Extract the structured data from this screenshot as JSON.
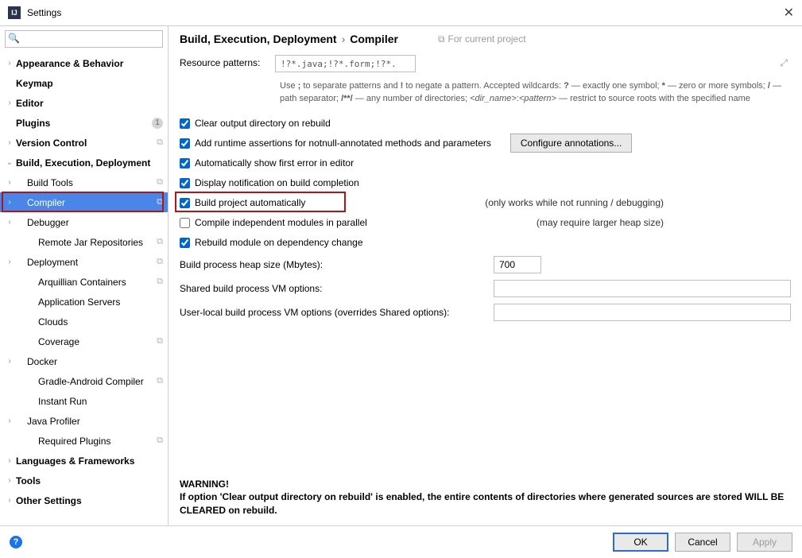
{
  "window": {
    "title": "Settings"
  },
  "search": {
    "placeholder": ""
  },
  "sidebar": {
    "items": [
      {
        "label": "Appearance & Behavior",
        "bold": true,
        "chev": ">",
        "depth": 0
      },
      {
        "label": "Keymap",
        "bold": true,
        "chev": "",
        "depth": 0
      },
      {
        "label": "Editor",
        "bold": true,
        "chev": ">",
        "depth": 0
      },
      {
        "label": "Plugins",
        "bold": true,
        "chev": "",
        "depth": 0,
        "badge": "1"
      },
      {
        "label": "Version Control",
        "bold": true,
        "chev": ">",
        "depth": 0,
        "copy": true
      },
      {
        "label": "Build, Execution, Deployment",
        "bold": true,
        "chev": "v",
        "depth": 0
      },
      {
        "label": "Build Tools",
        "bold": false,
        "chev": ">",
        "depth": 1,
        "copy": true
      },
      {
        "label": "Compiler",
        "bold": false,
        "chev": ">",
        "depth": 1,
        "copy": true,
        "selected": true
      },
      {
        "label": "Debugger",
        "bold": false,
        "chev": ">",
        "depth": 1
      },
      {
        "label": "Remote Jar Repositories",
        "bold": false,
        "chev": "",
        "depth": 2,
        "copy": true
      },
      {
        "label": "Deployment",
        "bold": false,
        "chev": ">",
        "depth": 1,
        "copy": true
      },
      {
        "label": "Arquillian Containers",
        "bold": false,
        "chev": "",
        "depth": 2,
        "copy": true
      },
      {
        "label": "Application Servers",
        "bold": false,
        "chev": "",
        "depth": 2
      },
      {
        "label": "Clouds",
        "bold": false,
        "chev": "",
        "depth": 2
      },
      {
        "label": "Coverage",
        "bold": false,
        "chev": "",
        "depth": 2,
        "copy": true
      },
      {
        "label": "Docker",
        "bold": false,
        "chev": ">",
        "depth": 1
      },
      {
        "label": "Gradle-Android Compiler",
        "bold": false,
        "chev": "",
        "depth": 2,
        "copy": true
      },
      {
        "label": "Instant Run",
        "bold": false,
        "chev": "",
        "depth": 2
      },
      {
        "label": "Java Profiler",
        "bold": false,
        "chev": ">",
        "depth": 1
      },
      {
        "label": "Required Plugins",
        "bold": false,
        "chev": "",
        "depth": 2,
        "copy": true
      },
      {
        "label": "Languages & Frameworks",
        "bold": true,
        "chev": ">",
        "depth": 0
      },
      {
        "label": "Tools",
        "bold": true,
        "chev": ">",
        "depth": 0
      },
      {
        "label": "Other Settings",
        "bold": true,
        "chev": ">",
        "depth": 0
      }
    ]
  },
  "breadcrumb": {
    "a": "Build, Execution, Deployment",
    "b": "Compiler",
    "for_project": "For current project"
  },
  "resource": {
    "label": "Resource patterns:",
    "value": "!?*.java;!?*.form;!?*.class;!?*.groovy;!?*.scala;!?*.flex;!?*.kt;!?*.clj;!?*.aj",
    "help": "Use ; to separate patterns and ! to negate a pattern. Accepted wildcards: ? — exactly one symbol; * — zero or more symbols; / — path separator; /**/ — any number of directories; <dir_name>:<pattern> — restrict to source roots with the specified name"
  },
  "checks": {
    "clear": "Clear output directory on rebuild",
    "addrt": "Add runtime assertions for notnull-annotated methods and parameters",
    "cfgbtn": "Configure annotations...",
    "autoerr": "Automatically show first error in editor",
    "notify": "Display notification on build completion",
    "buildauto": "Build project automatically",
    "buildauto_note": "(only works while not running / debugging)",
    "parallel": "Compile independent modules in parallel",
    "parallel_note": "(may require larger heap size)",
    "rebuild": "Rebuild module on dependency change"
  },
  "form": {
    "heap_label": "Build process heap size (Mbytes):",
    "heap_value": "700",
    "shared_label": "Shared build process VM options:",
    "user_label": "User-local build process VM options (overrides Shared options):"
  },
  "warning": {
    "title": "WARNING!",
    "text": "If option 'Clear output directory on rebuild' is enabled, the entire contents of directories where generated sources are stored WILL BE CLEARED on rebuild."
  },
  "footer": {
    "ok": "OK",
    "cancel": "Cancel",
    "apply": "Apply"
  }
}
